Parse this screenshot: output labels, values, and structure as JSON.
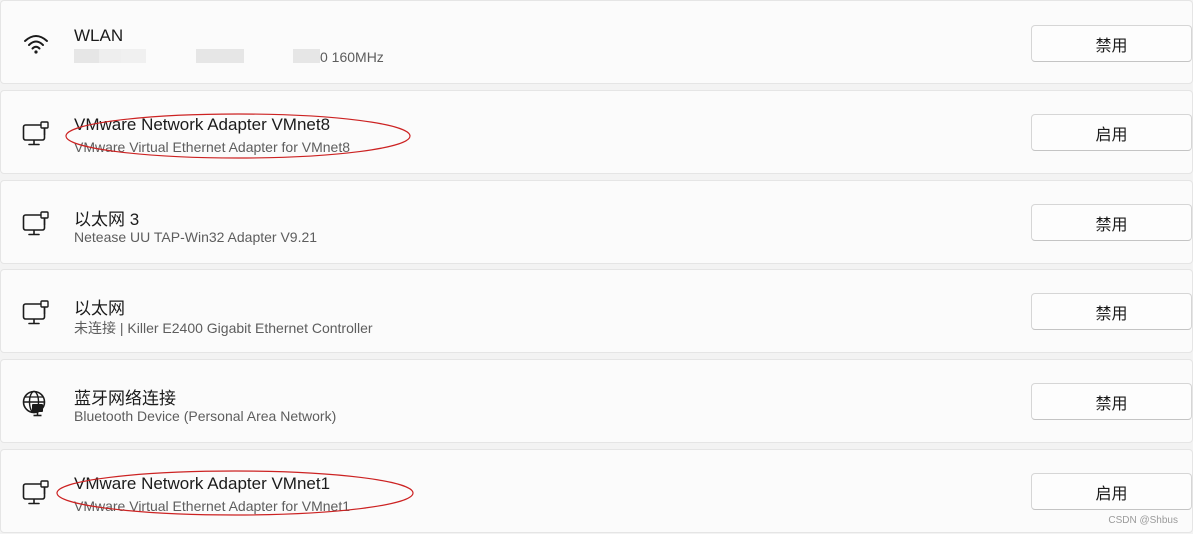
{
  "adapters": [
    {
      "title": "WLAN",
      "subtitle": "0 160MHz",
      "icon": "wifi-icon",
      "button_label": "禁用"
    },
    {
      "title": "VMware Network Adapter VMnet8",
      "subtitle": "VMware Virtual Ethernet Adapter for VMnet8",
      "icon": "ethernet-icon",
      "button_label": "启用",
      "annotation": "red-ellipse"
    },
    {
      "title": "以太网 3",
      "subtitle": "Netease UU TAP-Win32 Adapter V9.21",
      "icon": "ethernet-icon",
      "button_label": "禁用"
    },
    {
      "title": "以太网",
      "subtitle": "未连接 | Killer E2400 Gigabit Ethernet Controller",
      "icon": "ethernet-icon",
      "button_label": "禁用"
    },
    {
      "title": "蓝牙网络连接",
      "subtitle": "Bluetooth Device (Personal Area Network)",
      "icon": "globe-network-icon",
      "button_label": "禁用"
    },
    {
      "title": "VMware Network Adapter VMnet1",
      "subtitle": "VMware Virtual Ethernet Adapter for VMnet1",
      "icon": "ethernet-icon",
      "button_label": "启用",
      "annotation": "red-ellipse"
    }
  ],
  "watermark": "CSDN @Shbus",
  "colors": {
    "annotation": "#cc2222",
    "row_background": "#fbfbfb",
    "page_background": "#f3f3f3"
  }
}
